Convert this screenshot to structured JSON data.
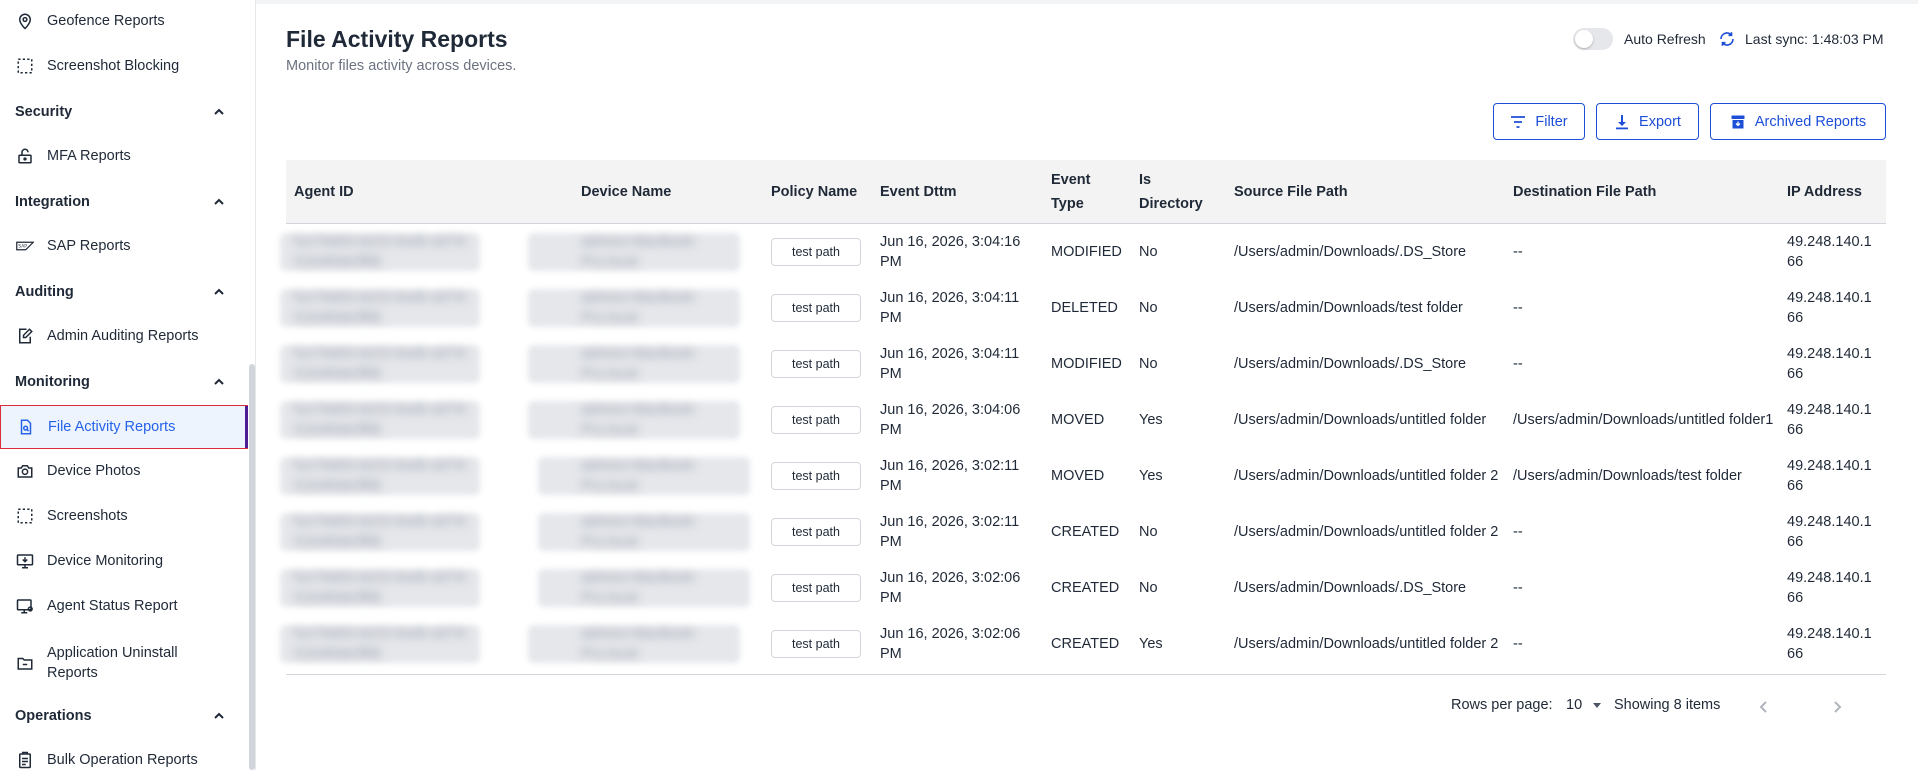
{
  "sidebar": {
    "items_top": [
      {
        "label": "Geofence Reports",
        "icon": "location-pin-icon"
      },
      {
        "label": "Screenshot Blocking",
        "icon": "dashed-square-icon"
      }
    ],
    "sections": [
      {
        "label": "Security"
      },
      {
        "label": "Integration"
      },
      {
        "label": "Auditing"
      },
      {
        "label": "Monitoring"
      },
      {
        "label": "Operations"
      }
    ],
    "security_items": [
      {
        "label": "MFA Reports",
        "icon": "lock-icon"
      }
    ],
    "integration_items": [
      {
        "label": "SAP Reports",
        "icon": "sap-icon"
      }
    ],
    "auditing_items": [
      {
        "label": "Admin Auditing Reports",
        "icon": "edit-document-icon"
      }
    ],
    "monitoring_items": [
      {
        "label": "File Activity Reports",
        "icon": "file-search-icon",
        "active": true
      },
      {
        "label": "Device Photos",
        "icon": "camera-icon"
      },
      {
        "label": "Screenshots",
        "icon": "dashed-square-icon"
      },
      {
        "label": "Device Monitoring",
        "icon": "monitor-download-icon"
      },
      {
        "label": "Agent Status Report",
        "icon": "monitor-user-icon"
      },
      {
        "label": "Application Uninstall Reports",
        "icon": "folder-uninstall-icon"
      }
    ],
    "operations_items": [
      {
        "label": "Bulk Operation Reports",
        "icon": "clipboard-icon"
      }
    ]
  },
  "header": {
    "title": "File Activity Reports",
    "subtitle": "Monitor files activity across devices.",
    "auto_refresh_label": "Auto Refresh",
    "auto_refresh_on": false,
    "last_sync": "Last sync: 1:48:03 PM"
  },
  "toolbar": {
    "filter_label": "Filter",
    "export_label": "Export",
    "archived_label": "Archived Reports"
  },
  "table": {
    "columns": {
      "agent_id": "Agent ID",
      "device_name": "Device Name",
      "policy_name": "Policy Name",
      "event_dttm": "Event Dttm",
      "event_type_1": "Event",
      "event_type_2": "Type",
      "is_directory_1": "Is",
      "is_directory_2": "Directory",
      "source_path": "Source File Path",
      "dest_path": "Destination File Path",
      "ip_address": "IP Address"
    },
    "rows": [
      {
        "agent_1": "fce79d93-dc03-5ed0-a5T6-",
        "agent_2": "516483dcff86",
        "device_1": "admins-MacBook-",
        "device_2": "Pro.local",
        "policy": "test path",
        "dttm": "Jun 16, 2026, 3:04:16 PM",
        "type": "MODIFIED",
        "dir": "No",
        "src": "/Users/admin/Downloads/.DS_Store",
        "dst": "--",
        "ip": "49.248.140.166"
      },
      {
        "agent_1": "fce79d93-dc03-5ed0-a5T6-",
        "agent_2": "516483dcff86",
        "device_1": "admins-MacBook-",
        "device_2": "Pro.local",
        "policy": "test path",
        "dttm": "Jun 16, 2026, 3:04:11 PM",
        "type": "DELETED",
        "dir": "No",
        "src": "/Users/admin/Downloads/test folder",
        "dst": "--",
        "ip": "49.248.140.166"
      },
      {
        "agent_1": "fce79d93-dc03-5ed0-a5T6-",
        "agent_2": "516483dcff86",
        "device_1": "admins-MacBook-",
        "device_2": "Pro.local",
        "policy": "test path",
        "dttm": "Jun 16, 2026, 3:04:11 PM",
        "type": "MODIFIED",
        "dir": "No",
        "src": "/Users/admin/Downloads/.DS_Store",
        "dst": "--",
        "ip": "49.248.140.166"
      },
      {
        "agent_1": "fce79d93-dc03-5ed0-a5T6-",
        "agent_2": "516483dcff86",
        "device_1": "admins-MacBook-",
        "device_2": "Pro.local",
        "policy": "test path",
        "dttm": "Jun 16, 2026, 3:04:06 PM",
        "type": "MOVED",
        "dir": "Yes",
        "src": "/Users/admin/Downloads/untitled folder",
        "dst": "/Users/admin/Downloads/untitled folder1",
        "ip": "49.248.140.166"
      },
      {
        "agent_1": "fce79d93-dc03-5ed0-a5T6-",
        "agent_2": "516483dcff86",
        "device_1": "admins-MacBook-",
        "device_2": "Pro.local",
        "policy": "test path",
        "dttm": "Jun 16, 2026, 3:02:11 PM",
        "type": "MOVED",
        "dir": "Yes",
        "src": "/Users/admin/Downloads/untitled folder 2",
        "dst": "/Users/admin/Downloads/test folder",
        "ip": "49.248.140.166"
      },
      {
        "agent_1": "fce79d93-dc03-5ed0-a5T6-",
        "agent_2": "516483dcff86",
        "device_1": "admins-MacBook-",
        "device_2": "Pro.local",
        "policy": "test path",
        "dttm": "Jun 16, 2026, 3:02:11 PM",
        "type": "CREATED",
        "dir": "No",
        "src": "/Users/admin/Downloads/untitled folder 2",
        "dst": "--",
        "ip": "49.248.140.166"
      },
      {
        "agent_1": "fce79d93-dc03-5ed0-a5T6-",
        "agent_2": "516483dcff86",
        "device_1": "admins-MacBook-",
        "device_2": "Pro.local",
        "policy": "test path",
        "dttm": "Jun 16, 2026, 3:02:06 PM",
        "type": "CREATED",
        "dir": "No",
        "src": "/Users/admin/Downloads/.DS_Store",
        "dst": "--",
        "ip": "49.248.140.166"
      },
      {
        "agent_1": "fce79d93-dc03-5ed0-a5T6-",
        "agent_2": "516483dcff86",
        "device_1": "admins-MacBook-",
        "device_2": "Pro.local",
        "policy": "test path",
        "dttm": "Jun 16, 2026, 3:02:06 PM",
        "type": "CREATED",
        "dir": "Yes",
        "src": "/Users/admin/Downloads/untitled folder 2",
        "dst": "--",
        "ip": "49.248.140.166"
      }
    ]
  },
  "pagination": {
    "rows_per_page_label": "Rows per page:",
    "rows_per_page_value": "10",
    "showing": "Showing 8 items"
  },
  "colors": {
    "accent": "#1d4ed8",
    "active_bg": "#eef4fd",
    "active_border": "#d92d3c",
    "active_bar": "#4c1d95"
  }
}
